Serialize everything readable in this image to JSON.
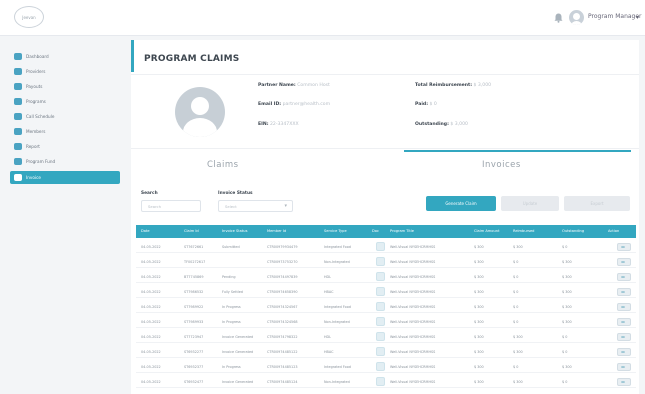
{
  "header": {
    "logo_text": "Jeevan",
    "user_label": "Program Manager",
    "icons": [
      "bell-icon",
      "user-avatar-icon",
      "chevron-down-icon"
    ]
  },
  "sidebar": {
    "items": [
      {
        "label": "Dashboard",
        "icon": "dashboard-icon"
      },
      {
        "label": "Providers",
        "icon": "providers-icon"
      },
      {
        "label": "Payouts",
        "icon": "payouts-icon"
      },
      {
        "label": "Programs",
        "icon": "programs-icon"
      },
      {
        "label": "Call Schedule",
        "icon": "calendar-icon"
      },
      {
        "label": "Members",
        "icon": "members-icon"
      },
      {
        "label": "Report",
        "icon": "report-icon"
      },
      {
        "label": "Program Fund",
        "icon": "fund-icon"
      },
      {
        "label": "Invoice",
        "icon": "invoice-icon",
        "active": true
      }
    ]
  },
  "page": {
    "title": "PROGRAM CLAIMS"
  },
  "profile": {
    "partner_label": "Partner Name:",
    "partner_value": "Common Host",
    "email_label": "Email ID:",
    "email_value": "partner@health.com",
    "ein_label": "EIN:",
    "ein_value": "22-3347XXX",
    "total_label": "Total Reimbursement:",
    "total_value": "$ 3,000",
    "paid_label": "Paid:",
    "paid_value": "$ 0",
    "outstanding_label": "Outstanding:",
    "outstanding_value": "$ 3,000"
  },
  "tabs": {
    "claims": "Claims",
    "invoices": "Invoices",
    "active": "invoices"
  },
  "filters": {
    "search_label": "Search",
    "search_placeholder": "Search",
    "status_label": "Invoice Status",
    "status_value": "Select"
  },
  "buttons": {
    "generate": "Generate Claim",
    "update": "Update",
    "export": "Export"
  },
  "table": {
    "columns": [
      "Date",
      "Claim Id",
      "Invoice Status",
      "Member Id",
      "Service Type",
      "Doc",
      "Program Title",
      "Claim Amount",
      "Reimbursed",
      "Outstanding",
      "Action"
    ],
    "rows": [
      [
        "04-05-2022",
        "ST7672661",
        "Submitted",
        "CTR00979934479",
        "Integrated Food",
        "",
        "Well-Visual NYSEHCRMHSS",
        "$ 300",
        "$ 300",
        "$ 0",
        ""
      ],
      [
        "04-05-2022",
        "TF00272617",
        "",
        "CTR00973753270",
        "Non-Integrated",
        "",
        "Well-Visual NYSEHCRMHSS",
        "$ 300",
        "$ 0",
        "$ 300",
        ""
      ],
      [
        "04-05-2022",
        "BT7745869",
        "Pending",
        "CTR00974497839",
        "HDL",
        "",
        "Well-Visual NYSEHCRMHSS",
        "$ 300",
        "$ 0",
        "$ 300",
        ""
      ],
      [
        "04-05-2022",
        "ST7986532",
        "Fully Settled",
        "CTR00974658390",
        "HBAC",
        "",
        "Well-Visual NYSEHCRMHSS",
        "$ 300",
        "$ 0",
        "$ 300",
        ""
      ],
      [
        "04-05-2022",
        "ST7989922",
        "In Progress",
        "CTR00974324567",
        "Integrated Food",
        "",
        "Well-Visual NYSEHCRMHSS",
        "$ 300",
        "$ 0",
        "$ 300",
        ""
      ],
      [
        "04-05-2022",
        "ST7989933",
        "In Progress",
        "CTR00974324568",
        "Non-Integrated",
        "",
        "Well-Visual NYSEHCRMHSS",
        "$ 300",
        "$ 0",
        "$ 300",
        ""
      ],
      [
        "04-05-2022",
        "ST7723947",
        "Invoice Generated",
        "CTR00974798322",
        "HDL",
        "",
        "Well-Visual NYSEHCRMHSS",
        "$ 300",
        "$ 300",
        "$ 0",
        ""
      ],
      [
        "04-05-2022",
        "ST6932277",
        "Invoice Generated",
        "CTR00974485122",
        "HBAC",
        "",
        "Well-Visual NYSEHCRMHSS",
        "$ 300",
        "$ 300",
        "$ 0",
        ""
      ],
      [
        "04-05-2022",
        "ST6932377",
        "In Progress",
        "CTR00974485123",
        "Integrated Food",
        "",
        "Well-Visual NYSEHCRMHSS",
        "$ 300",
        "$ 0",
        "$ 300",
        ""
      ],
      [
        "04-05-2022",
        "ST6932477",
        "Invoice Generated",
        "CTR00974485124",
        "Non-Integrated",
        "",
        "Well-Visual NYSEHCRMHSS",
        "$ 300",
        "$ 300",
        "$ 0",
        ""
      ]
    ]
  },
  "colors": {
    "accent": "#33a7c0",
    "text_dark": "#3d4650",
    "text_muted": "#b7bec6"
  }
}
